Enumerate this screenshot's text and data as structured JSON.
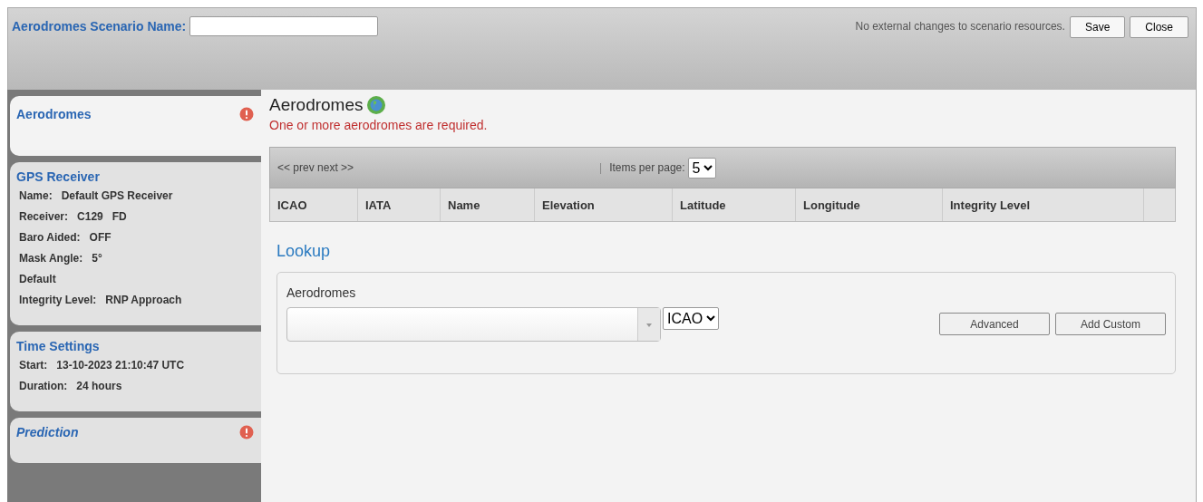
{
  "header": {
    "label": "Aerodromes Scenario Name:",
    "status": "No external changes to scenario resources.",
    "buttons": [
      "Save",
      "Close"
    ]
  },
  "sidebar": {
    "items": [
      {
        "title": "Aerodromes",
        "selected": true,
        "error": true,
        "italic": false
      },
      {
        "title": "GPS Receiver",
        "selected": false,
        "error": false,
        "italic": false,
        "details": [
          {
            "label": "Name:",
            "value": "Default GPS Receiver"
          },
          {
            "label": "Receiver:",
            "value": "C129   FD"
          },
          {
            "label": "Baro Aided:",
            "value": "OFF"
          },
          {
            "label": "Mask Angle:",
            "value": "5°"
          },
          {
            "label": "Default"
          },
          {
            "label": "Integrity Level:",
            "value": "RNP Approach"
          }
        ]
      },
      {
        "title": "Time Settings",
        "selected": false,
        "error": false,
        "italic": false,
        "details": [
          {
            "label": "Start:",
            "value": "13-10-2023 21:10:47 UTC"
          },
          {
            "label": "Duration:",
            "value": "24 hours"
          }
        ]
      },
      {
        "title": "Prediction",
        "selected": false,
        "error": true,
        "italic": true
      }
    ]
  },
  "main": {
    "title": "Aerodromes",
    "error_message": "One or more aerodromes are required.",
    "pager": {
      "nav": "<< prev next >>",
      "separator": "|",
      "items_label": "Items per page:",
      "items_value": "5"
    },
    "table": {
      "columns": [
        "ICAO",
        "IATA",
        "Name",
        "Elevation",
        "Latitude",
        "Longitude",
        "Integrity Level"
      ]
    },
    "lookup": {
      "title": "Lookup",
      "field_label": "Aerodromes",
      "code_type": "ICAO",
      "buttons": [
        "Advanced",
        "Add Custom"
      ]
    }
  }
}
